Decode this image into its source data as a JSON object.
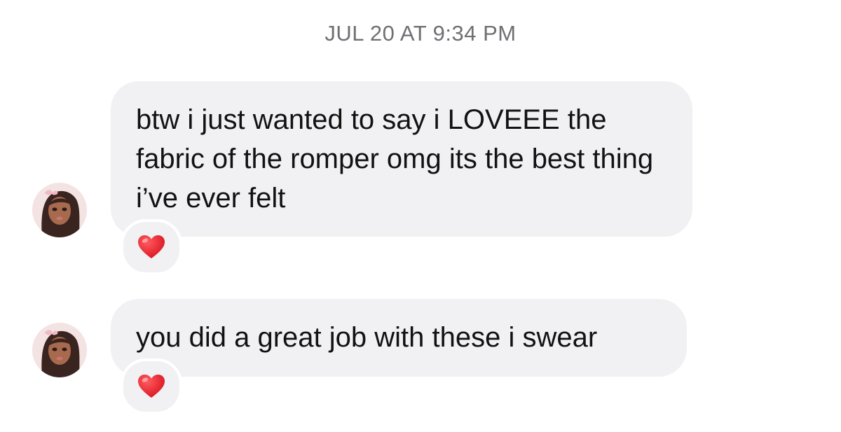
{
  "timestamp": "JUL 20 AT 9:34 PM",
  "messages": [
    {
      "text": "btw i just wanted to say i LOVEEE the fabric of the romper omg its the best thing i’ve ever felt",
      "reaction": "red-heart"
    },
    {
      "text": "you did a great job with these i swear",
      "reaction": "red-heart"
    }
  ],
  "colors": {
    "bubble": "#f1f1f3",
    "timestamp": "#6f6f74",
    "heart": "#e3141d",
    "background": "#ffffff"
  },
  "icons": {
    "avatar": "sender-avatar",
    "reaction": "heart-icon"
  }
}
